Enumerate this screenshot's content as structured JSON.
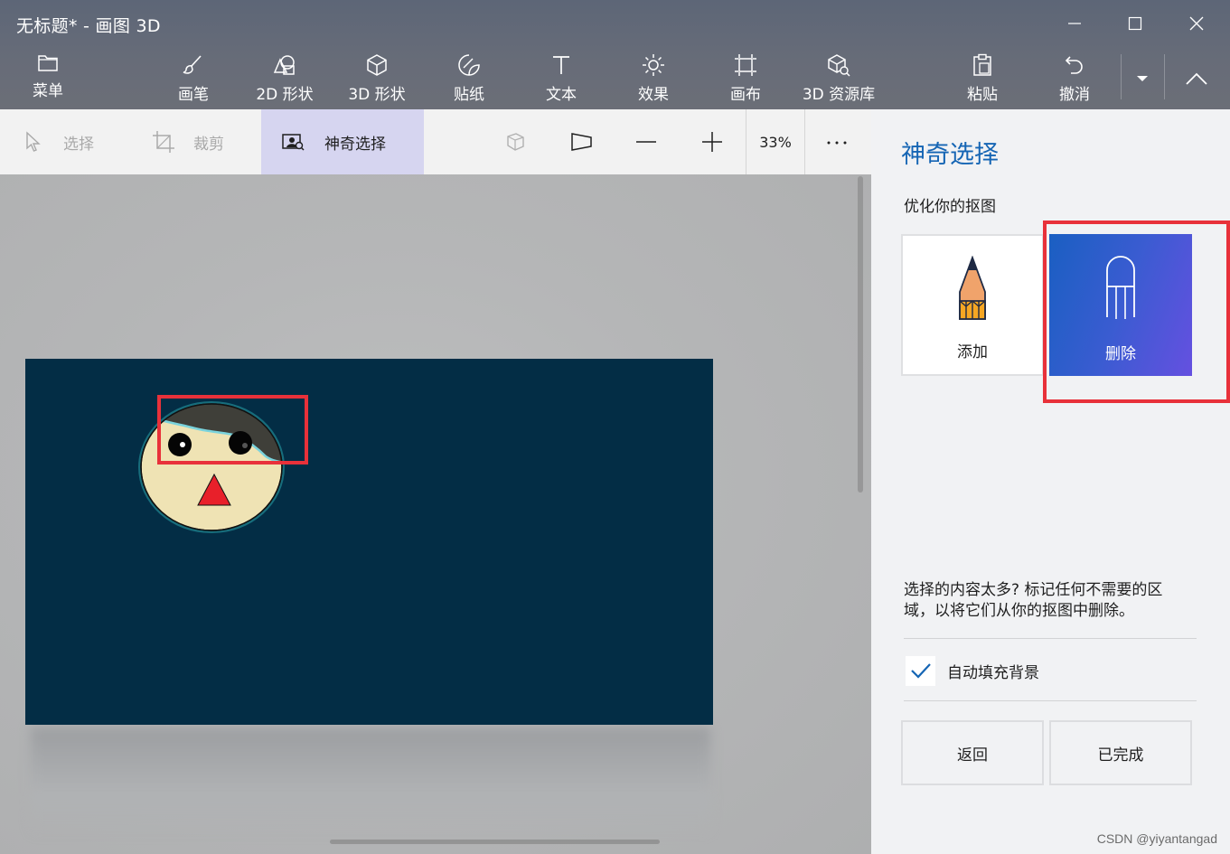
{
  "window": {
    "title": "无标题* - 画图 3D"
  },
  "toolbar": {
    "menu": "菜单",
    "tools": [
      {
        "label": "画笔",
        "icon": "brush-icon"
      },
      {
        "label": "2D 形状",
        "icon": "shapes-2d-icon"
      },
      {
        "label": "3D 形状",
        "icon": "cube-icon"
      },
      {
        "label": "贴纸",
        "icon": "sticker-icon"
      },
      {
        "label": "文本",
        "icon": "text-icon"
      },
      {
        "label": "效果",
        "icon": "effects-icon"
      },
      {
        "label": "画布",
        "icon": "canvas-icon"
      },
      {
        "label": "3D 资源库",
        "icon": "3d-library-icon"
      }
    ],
    "paste": "粘贴",
    "undo": "撤消"
  },
  "subbar": {
    "select": "选择",
    "crop": "裁剪",
    "magic_select": "神奇选择",
    "zoom": "33%"
  },
  "panel": {
    "title": "神奇选择",
    "subtitle": "优化你的抠图",
    "add": "添加",
    "remove": "删除",
    "help": "选择的内容太多? 标记任何不需要的区域，以将它们从你的抠图中删除。",
    "autofill_label": "自动填充背景",
    "autofill_checked": true,
    "back": "返回",
    "done": "已完成"
  },
  "colors": {
    "accent": "#1565b4",
    "canvas_bg": "#032d45",
    "highlight_box": "#e8313a",
    "face_fill": "#efe3b4",
    "hair_fill": "#3f3f39",
    "nose_fill": "#e8202a"
  },
  "watermark": "CSDN @yiyantangad"
}
